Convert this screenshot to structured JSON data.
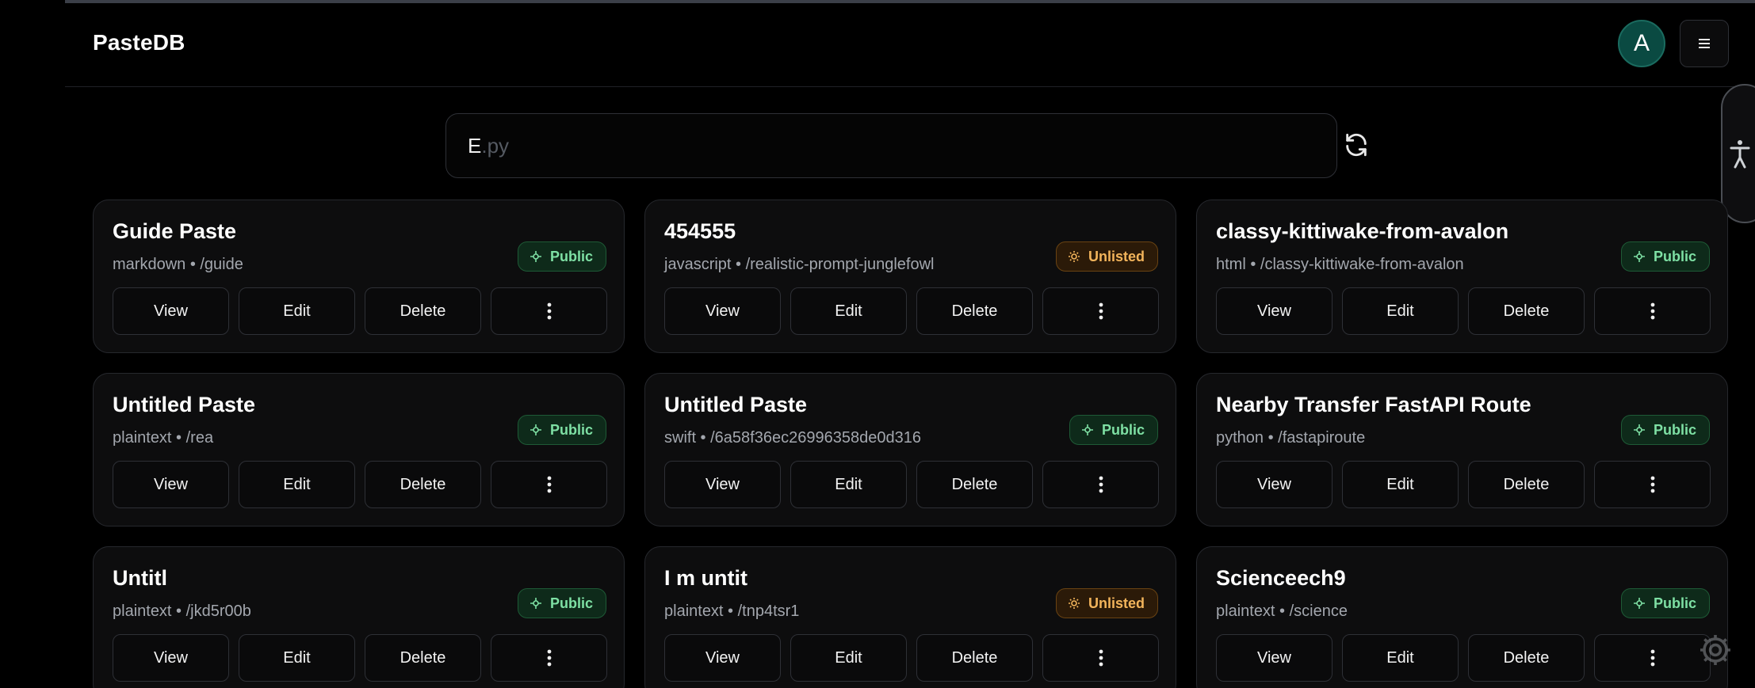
{
  "app": {
    "brand": "PasteDB",
    "avatar_initial": "A"
  },
  "search": {
    "typed": "E",
    "ghost": ".py"
  },
  "actions": {
    "view": "View",
    "edit": "Edit",
    "delete": "Delete"
  },
  "visibility_labels": {
    "public": "Public",
    "unlisted": "Unlisted"
  },
  "colors": {
    "public": "#7ee0a4",
    "unlisted": "#f2b45b",
    "avatar": "#0a4a42"
  },
  "cards": [
    {
      "title": "Guide Paste",
      "meta": "markdown • /guide",
      "visibility": "public"
    },
    {
      "title": "454555",
      "meta": "javascript • /realistic-prompt-junglefowl",
      "visibility": "unlisted"
    },
    {
      "title": "classy-kittiwake-from-avalon",
      "meta": "html • /classy-kittiwake-from-avalon",
      "visibility": "public"
    },
    {
      "title": "Untitled Paste",
      "meta": "plaintext • /rea",
      "visibility": "public"
    },
    {
      "title": "Untitled Paste",
      "meta": "swift • /6a58f36ec26996358de0d316",
      "visibility": "public"
    },
    {
      "title": "Nearby Transfer FastAPI Route",
      "meta": "python • /fastapiroute",
      "visibility": "public"
    },
    {
      "title": "Untitl",
      "meta": "plaintext • /jkd5r00b",
      "visibility": "public"
    },
    {
      "title": "I m untit",
      "meta": "plaintext • /tnp4tsr1",
      "visibility": "unlisted"
    },
    {
      "title": "Scienceech9",
      "meta": "plaintext • /science",
      "visibility": "public"
    }
  ]
}
